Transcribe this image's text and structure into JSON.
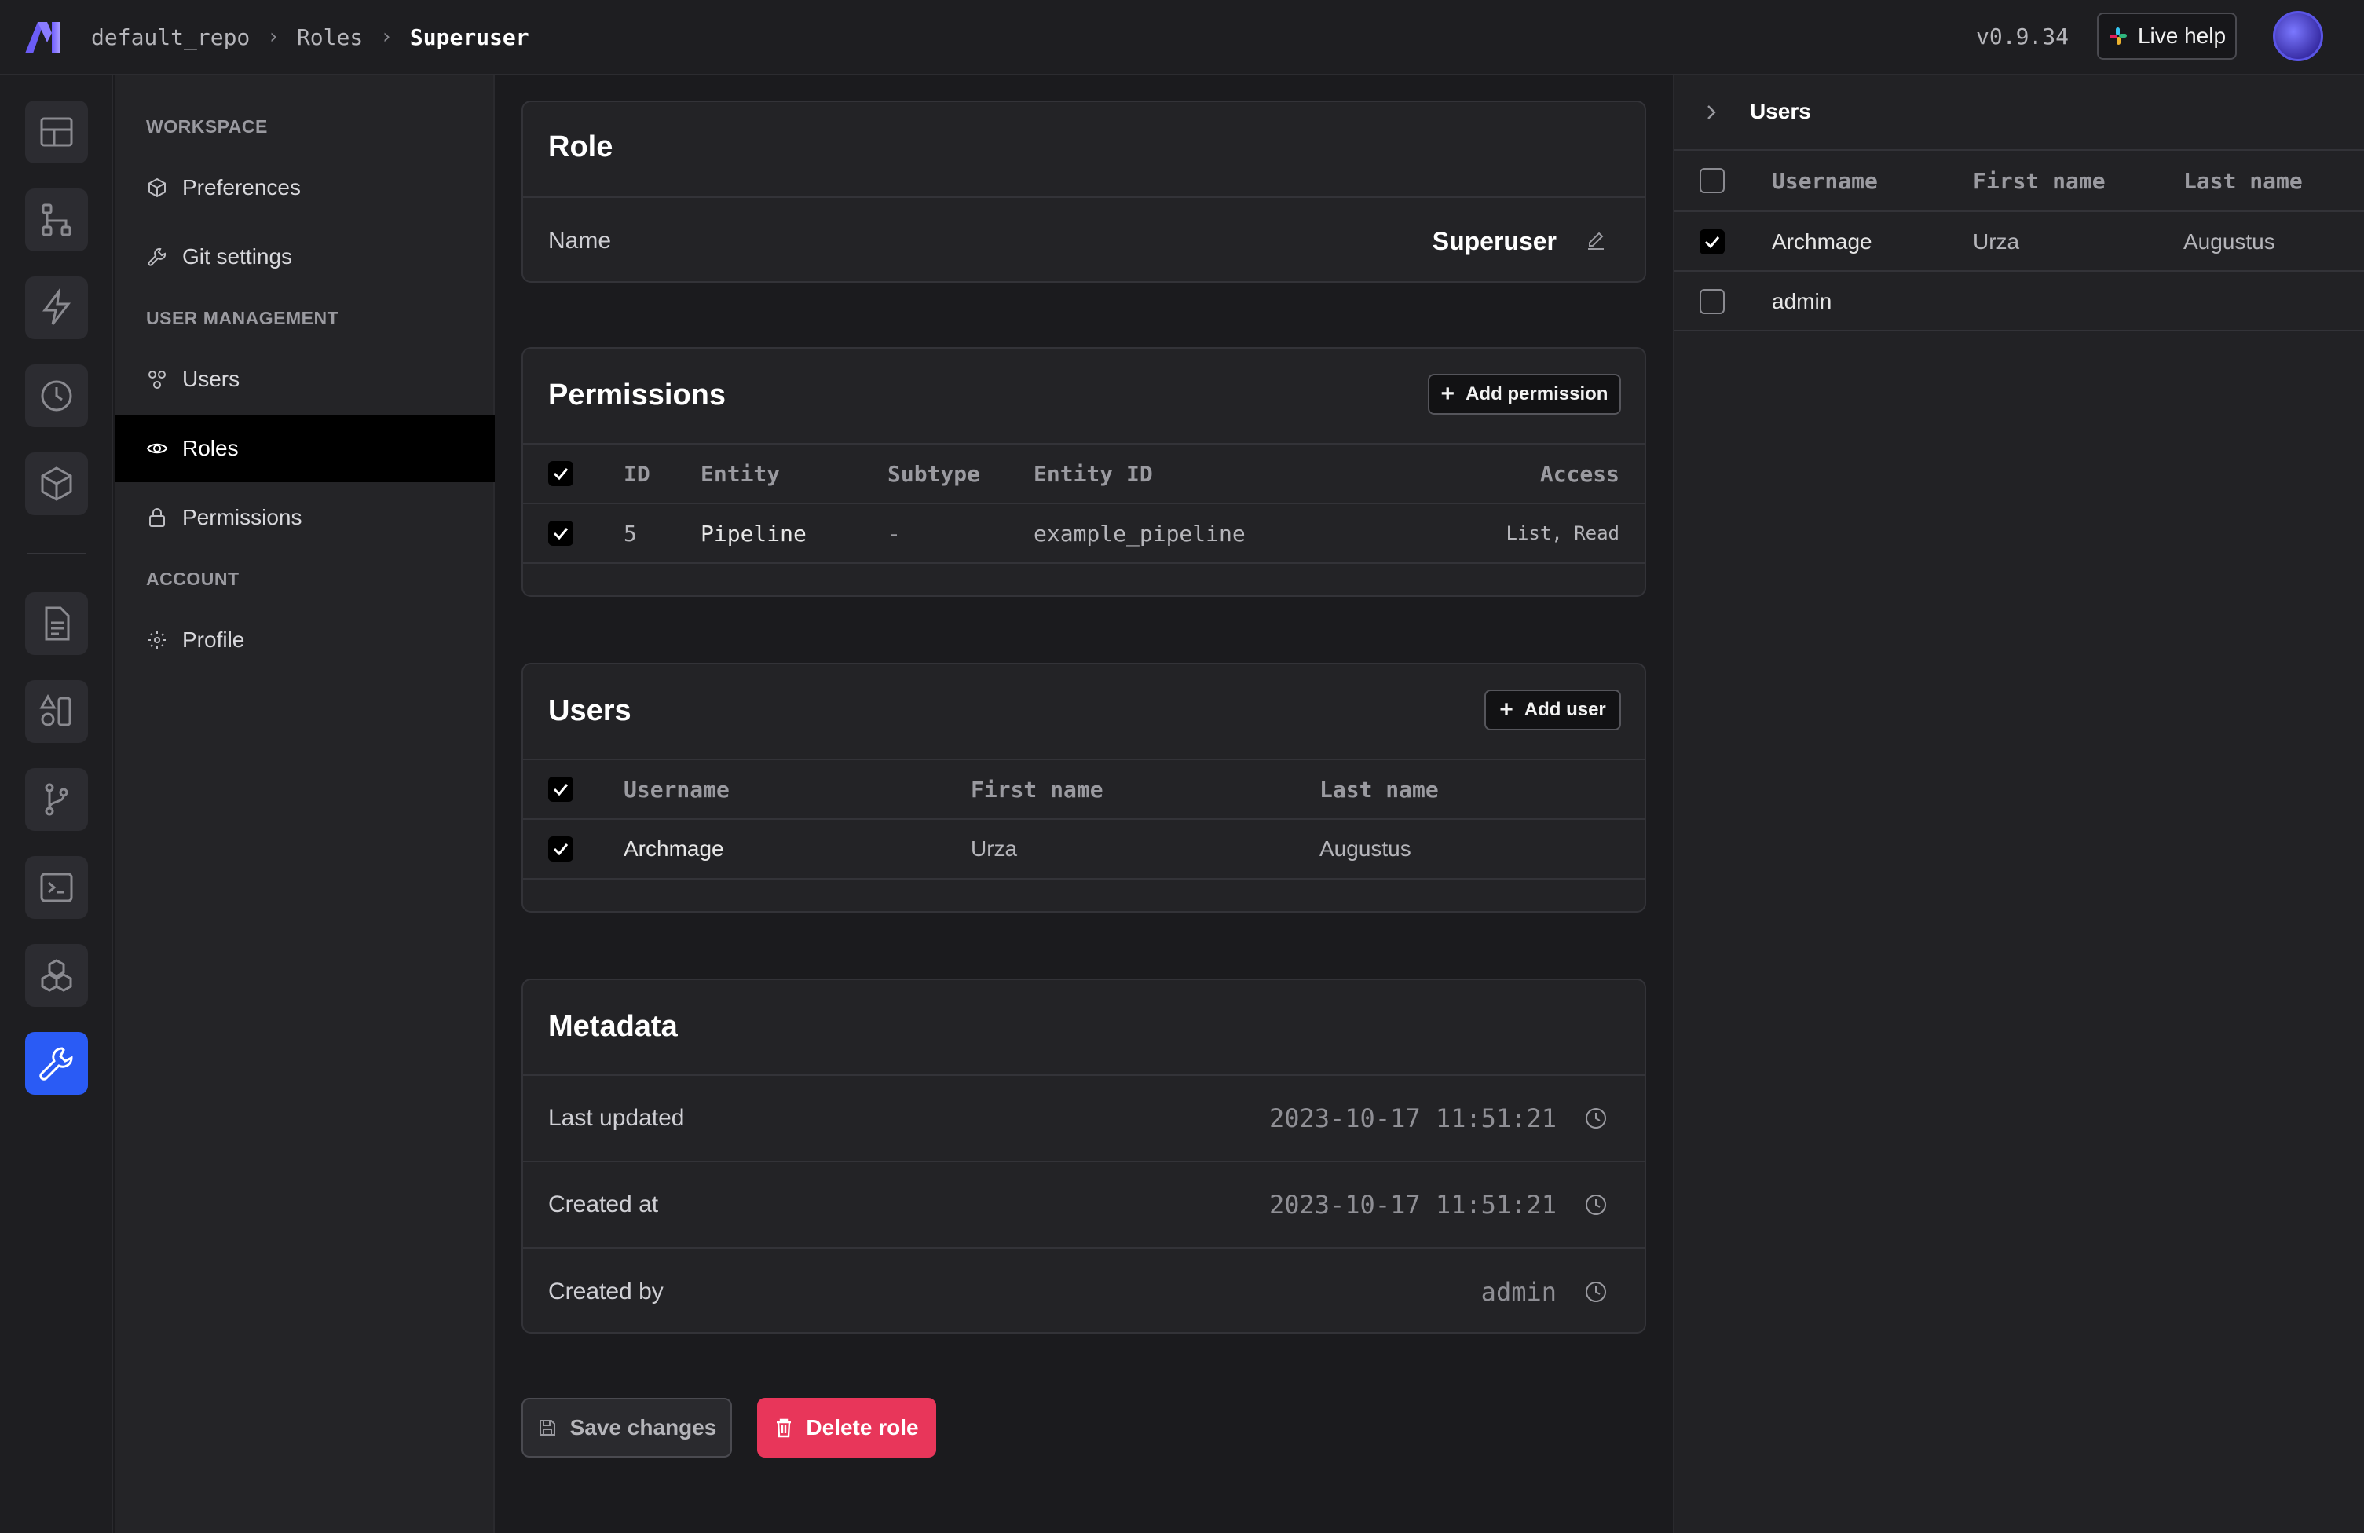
{
  "header": {
    "breadcrumbs": [
      "default_repo",
      "Roles",
      "Superuser"
    ],
    "version": "v0.9.34",
    "live_help": "Live help"
  },
  "rail": {
    "icons": [
      "layout-icon",
      "pipelines-icon",
      "triggers-icon",
      "history-icon",
      "cube-icon",
      "file-icon",
      "blocks-icon",
      "git-branch-icon",
      "terminal-icon",
      "dependencies-icon",
      "wrench-icon"
    ],
    "active": "wrench-icon"
  },
  "nav": {
    "sections": [
      {
        "title": "WORKSPACE",
        "items": [
          {
            "label": "Preferences",
            "icon": "cube-outline-icon"
          },
          {
            "label": "Git settings",
            "icon": "wrench-small-icon"
          }
        ]
      },
      {
        "title": "USER MANAGEMENT",
        "items": [
          {
            "label": "Users",
            "icon": "users-icon"
          },
          {
            "label": "Roles",
            "icon": "eye-icon"
          },
          {
            "label": "Permissions",
            "icon": "lock-icon"
          }
        ]
      },
      {
        "title": "ACCOUNT",
        "items": [
          {
            "label": "Profile",
            "icon": "sun-icon"
          }
        ]
      }
    ],
    "active": "Roles"
  },
  "role": {
    "title": "Role",
    "name_label": "Name",
    "name_value": "Superuser"
  },
  "permissions": {
    "title": "Permissions",
    "add_button": "Add permission",
    "columns": [
      "ID",
      "Entity",
      "Subtype",
      "Entity ID",
      "Access"
    ],
    "rows": [
      {
        "checked": true,
        "id": "5",
        "entity": "Pipeline",
        "subtype": "-",
        "entity_id": "example_pipeline",
        "access": "List, Read"
      }
    ]
  },
  "users": {
    "title": "Users",
    "add_button": "Add user",
    "columns": [
      "Username",
      "First name",
      "Last name"
    ],
    "rows": [
      {
        "checked": true,
        "username": "Archmage",
        "first_name": "Urza",
        "last_name": "Augustus"
      }
    ]
  },
  "metadata": {
    "title": "Metadata",
    "rows": [
      {
        "label": "Last updated",
        "value": "2023-10-17 11:51:21"
      },
      {
        "label": "Created at",
        "value": "2023-10-17 11:51:21"
      },
      {
        "label": "Created by",
        "value": "admin"
      }
    ]
  },
  "actions": {
    "save": "Save changes",
    "delete": "Delete role"
  },
  "right_panel": {
    "title": "Users",
    "columns": [
      "Username",
      "First name",
      "Last name"
    ],
    "rows": [
      {
        "checked": true,
        "username": "Archmage",
        "first_name": "Urza",
        "last_name": "Augustus"
      },
      {
        "checked": false,
        "username": "admin",
        "first_name": "",
        "last_name": ""
      }
    ]
  },
  "colors": {
    "accent": "#2a5bf5",
    "danger": "#e8365a",
    "background": "#1b1b1e"
  }
}
